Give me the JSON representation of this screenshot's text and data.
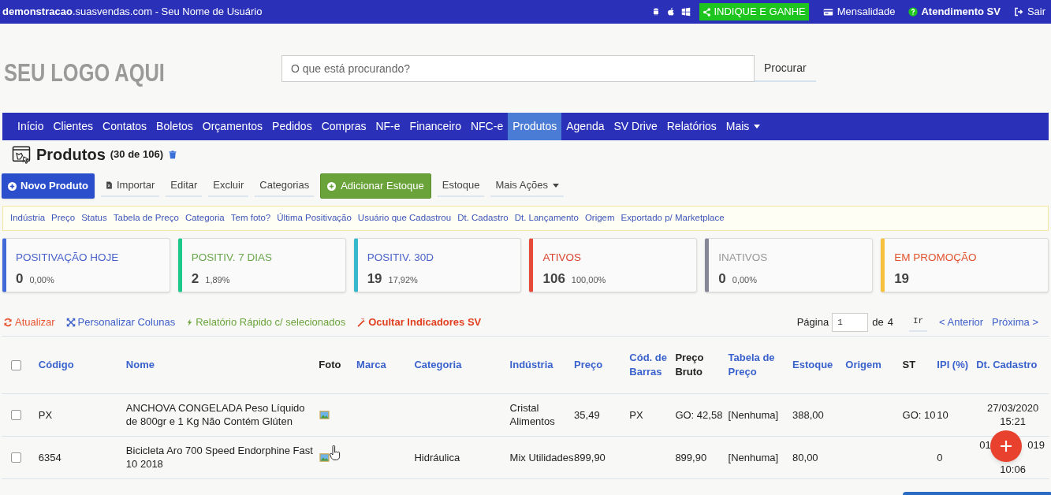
{
  "top_bar": {
    "site_host": "demonstracao",
    "site_domain": ".suasvendas.com",
    "user": " - Seu Nome de Usuário",
    "promo": "INDIQUE E GANHE",
    "links": [
      {
        "kind": "billing",
        "label": "Mensalidade"
      },
      {
        "kind": "help",
        "label": "Atendimento SV"
      },
      {
        "kind": "logout",
        "label": "Sair"
      }
    ]
  },
  "logo": "SEU LOGO AQUI",
  "search": {
    "placeholder": "O que está procurando?",
    "button": "Procurar"
  },
  "nav": [
    {
      "label": "Início",
      "selected": false
    },
    {
      "label": "Clientes",
      "selected": false
    },
    {
      "label": "Contatos",
      "selected": false
    },
    {
      "label": "Boletos",
      "selected": false
    },
    {
      "label": "Orçamentos",
      "selected": false
    },
    {
      "label": "Pedidos",
      "selected": false
    },
    {
      "label": "Compras",
      "selected": false
    },
    {
      "label": "NF-e",
      "selected": false
    },
    {
      "label": "Financeiro",
      "selected": false
    },
    {
      "label": "NFC-e",
      "selected": false
    },
    {
      "label": "Produtos",
      "selected": true
    },
    {
      "label": "Agenda",
      "selected": false
    },
    {
      "label": "SV Drive",
      "selected": false
    },
    {
      "label": "Relatórios",
      "selected": false
    },
    {
      "label": "Mais",
      "selected": false,
      "dropdown": true
    }
  ],
  "page": {
    "title": "Produtos",
    "count": "(30 de 106)"
  },
  "actions": [
    {
      "kind": "primary",
      "label": "Novo Produto"
    },
    {
      "kind": "import",
      "label": "Importar"
    },
    {
      "kind": "plain",
      "label": "Editar"
    },
    {
      "kind": "plain",
      "label": "Excluir"
    },
    {
      "kind": "plain",
      "label": "Categorias"
    },
    {
      "kind": "success",
      "label": "Adicionar Estoque"
    },
    {
      "kind": "plain",
      "label": "Estoque"
    },
    {
      "kind": "dropdown",
      "label": "Mais Ações"
    }
  ],
  "filters": [
    "Indústria",
    "Preço",
    "Status",
    "Tabela de Preço",
    "Categoria",
    "Tem foto?",
    "Última Positivação",
    "Usuário que Cadastrou",
    "Dt. Cadastro",
    "Dt. Lançamento",
    "Origem",
    "Exportado p/ Marketplace"
  ],
  "cards": [
    {
      "title": "POSITIVAÇÃO HOJE",
      "value": "0",
      "percent": "0,00%",
      "color": "#4169d8"
    },
    {
      "title": "POSITIV. 7 DIAS",
      "value": "2",
      "percent": "1,89%",
      "color": "#1cc88a"
    },
    {
      "title": "POSITIV. 30D",
      "value": "19",
      "percent": "17,92%",
      "color": "#36b9cc"
    },
    {
      "title": "ATIVOS",
      "value": "106",
      "percent": "100,00%",
      "color": "#e74a3b"
    },
    {
      "title": "INATIVOS",
      "value": "0",
      "percent": "0,00%",
      "color": "#858796"
    },
    {
      "title": "EM PROMOÇÃO",
      "value": "19",
      "color": "#f6c23e"
    }
  ],
  "tools": [
    {
      "kind": "refresh",
      "label": "Atualizar"
    },
    {
      "kind": "columns",
      "label": "Personalizar Colunas"
    },
    {
      "kind": "report",
      "label": "Relatório Rápido c/ selecionados"
    },
    {
      "kind": "hide",
      "label": "Ocultar Indicadores SV"
    }
  ],
  "pagination": {
    "label": "Página",
    "page": "1",
    "of": "de",
    "total": "4",
    "go": "Ir",
    "prev": "< Anterior",
    "next": "Próxima >"
  },
  "table": {
    "select_all_checked": false,
    "columns": [
      {
        "label": "Código",
        "sortable": true
      },
      {
        "label": "Nome",
        "sortable": true
      },
      {
        "label": "Foto",
        "sortable": false
      },
      {
        "label": "Marca",
        "sortable": true
      },
      {
        "label": "Categoria",
        "sortable": true
      },
      {
        "label": "Indústria",
        "sortable": true
      },
      {
        "label": "Preço",
        "sortable": true
      },
      {
        "label": "Cód. de Barras",
        "sortable": true
      },
      {
        "label": "Preço Bruto",
        "sortable": false
      },
      {
        "label": "Tabela de Preço",
        "sortable": true
      },
      {
        "label": "Estoque",
        "sortable": true
      },
      {
        "label": "Origem",
        "sortable": true
      },
      {
        "label": "ST",
        "sortable": false
      },
      {
        "label": "IPI (%)",
        "sortable": true
      },
      {
        "label": "Dt. Cadastro",
        "sortable": true
      }
    ],
    "rows": [
      {
        "checked": false,
        "cells": [
          "PX",
          "ANCHOVA CONGELADA Peso Líquido de 800gr e 1 Kg Não Contém Glúten",
          "",
          "",
          "",
          "Cristal Alimentos",
          "35,49",
          "PX",
          "GO: 42,58",
          "[Nenhuma]",
          "388,00",
          "",
          "GO: 10",
          "10",
          [
            "27/03/2020",
            "15:21"
          ]
        ],
        "photo": true
      },
      {
        "checked": false,
        "cells": [
          "6354",
          "Bicicleta Aro 700 Speed Endorphine Fast 10 2018",
          "",
          "",
          "Hidráulica",
          "Mix Utilidades",
          "899,90",
          "",
          "899,90",
          "[Nenhuma]",
          "80,00",
          "",
          "",
          "0",
          [
            "01",
            "019",
            "10:06"
          ]
        ],
        "photo": true
      }
    ]
  }
}
